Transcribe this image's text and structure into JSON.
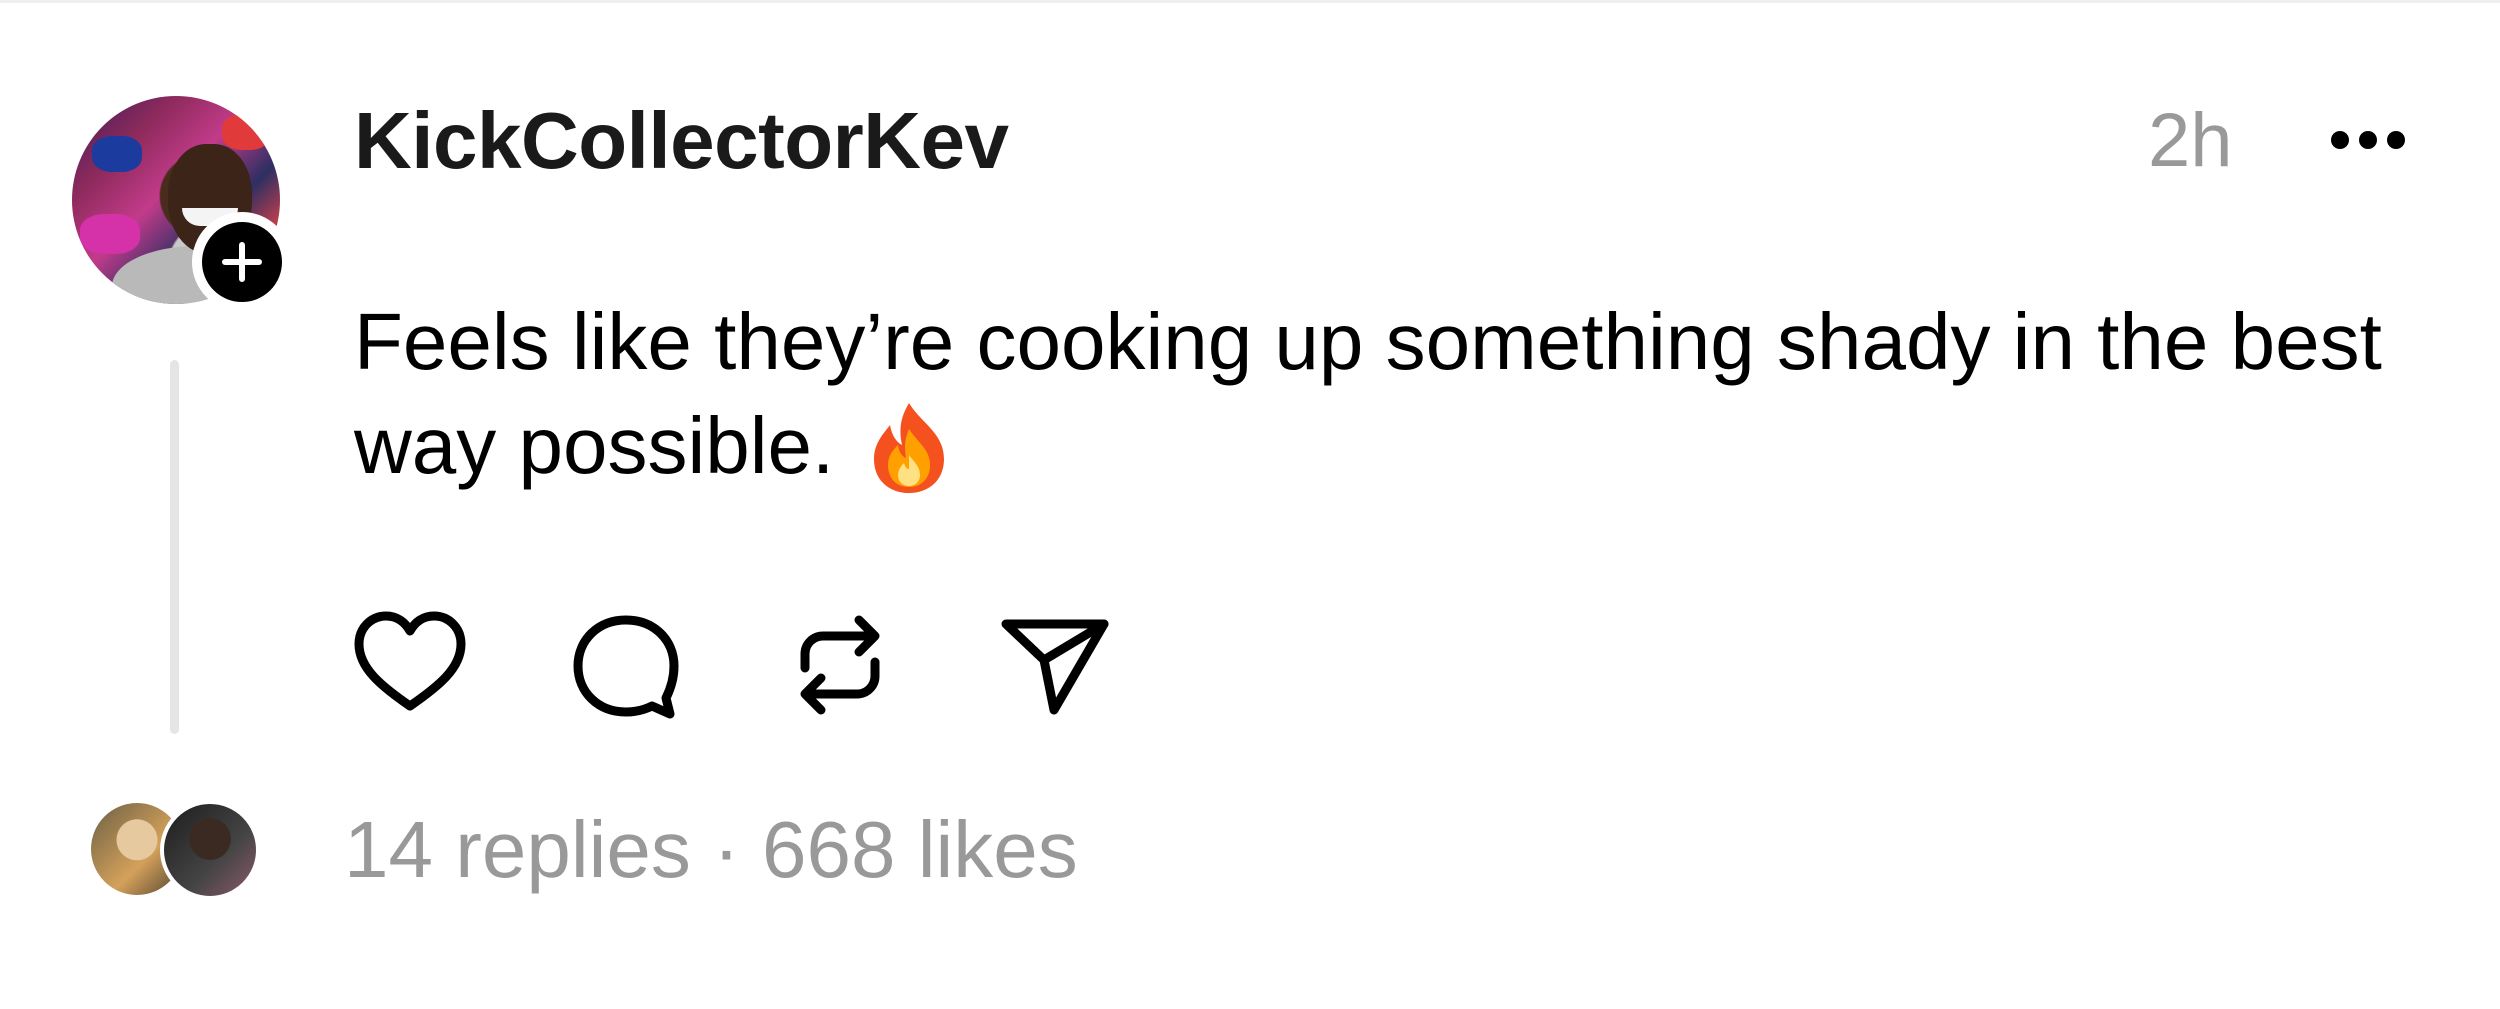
{
  "post": {
    "username": "KickCollectorKev",
    "time": "2h",
    "text": "Feels like they’re cooking up something shady in the best way possible.",
    "emoji_icon": "fire-emoji",
    "replies": "14 replies",
    "separator": "·",
    "likes": "668 likes"
  },
  "icons": {
    "more": "more-icon",
    "follow": "plus-icon",
    "like": "heart-icon",
    "reply": "comment-icon",
    "repost": "repost-icon",
    "share": "send-icon"
  },
  "colors": {
    "text": "#000000",
    "muted": "#999999",
    "thread_line": "#e5e5e5"
  }
}
